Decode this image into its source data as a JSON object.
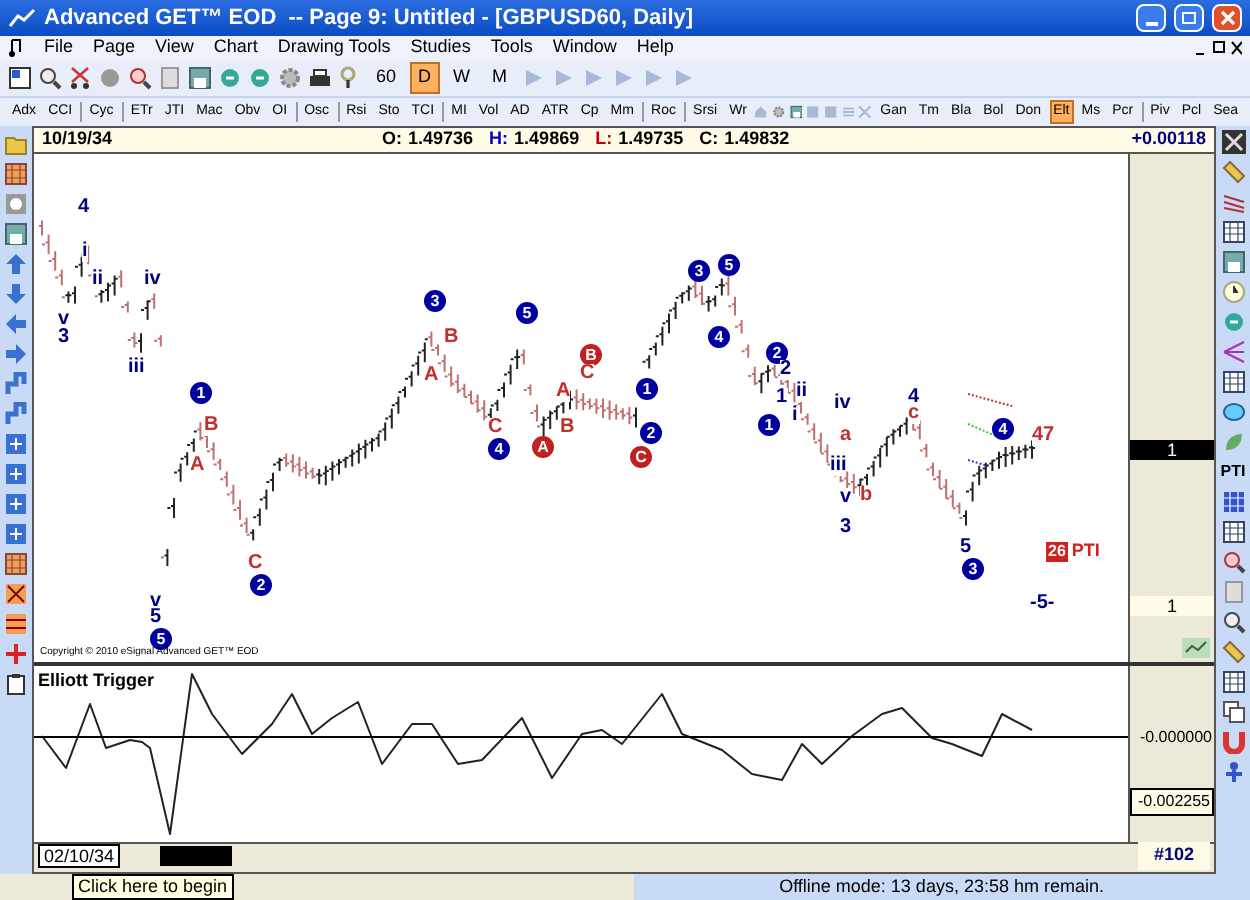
{
  "window": {
    "title": "Advanced GET™ EOD  -- Page 9: Untitled - [GBPUSD60, Daily]"
  },
  "menu": [
    "File",
    "Page",
    "View",
    "Chart",
    "Drawing Tools",
    "Studies",
    "Tools",
    "Window",
    "Help"
  ],
  "timeframes": [
    {
      "label": "60",
      "selected": false
    },
    {
      "label": "D",
      "selected": true
    },
    {
      "label": "W",
      "selected": false
    },
    {
      "label": "M",
      "selected": false
    }
  ],
  "study_groups": [
    [
      {
        "label": "Adx",
        "selected": false
      },
      {
        "label": "CCI",
        "selected": false
      }
    ],
    [
      {
        "label": "Cyc",
        "selected": false
      }
    ],
    [
      {
        "label": "ETr",
        "selected": false
      },
      {
        "label": "JTI",
        "selected": false
      },
      {
        "label": "Mac",
        "selected": false
      },
      {
        "label": "Obv",
        "selected": false
      },
      {
        "label": "OI",
        "selected": false
      }
    ],
    [
      {
        "label": "Osc",
        "selected": false
      }
    ],
    [
      {
        "label": "Rsi",
        "selected": false
      },
      {
        "label": "Sto",
        "selected": false
      },
      {
        "label": "TCI",
        "selected": false
      }
    ],
    [
      {
        "label": "MI",
        "selected": false
      },
      {
        "label": "Vol",
        "selected": false
      },
      {
        "label": "AD",
        "selected": false
      },
      {
        "label": "ATR",
        "selected": false
      },
      {
        "label": "Cp",
        "selected": false
      },
      {
        "label": "Mm",
        "selected": false
      }
    ],
    [
      {
        "label": "Roc",
        "selected": false
      }
    ],
    [
      {
        "label": "Srsi",
        "selected": false
      },
      {
        "label": "Wr",
        "selected": false
      }
    ]
  ],
  "study_groups_right": [
    [
      {
        "label": "Gan",
        "selected": false
      },
      {
        "label": "Tm",
        "selected": false
      },
      {
        "label": "Bla",
        "selected": false
      },
      {
        "label": "Bol",
        "selected": false
      },
      {
        "label": "Don",
        "selected": false
      },
      {
        "label": "Elt",
        "selected": true
      },
      {
        "label": "Ms",
        "selected": false
      },
      {
        "label": "Pcr",
        "selected": false
      }
    ],
    [
      {
        "label": "Piv",
        "selected": false
      },
      {
        "label": "Pcl",
        "selected": false
      },
      {
        "label": "Sea",
        "selected": false
      }
    ]
  ],
  "chart": {
    "date": "10/19/34",
    "ohlc": [
      {
        "label": "O:",
        "value": "1.49736",
        "color": "#000000"
      },
      {
        "label": "H:",
        "value": "1.49869",
        "color": "#0000c0"
      },
      {
        "label": "L:",
        "value": "1.49735",
        "color": "#c00000"
      },
      {
        "label": "C:",
        "value": "1.49832",
        "color": "#000000"
      }
    ],
    "change": "+0.00118",
    "copyright": "Copyright © 2010 eSignal Advanced GET™ EOD",
    "scale_labels": [
      {
        "text": "1",
        "highlighted": true
      },
      {
        "text": "1",
        "highlighted": false
      }
    ],
    "wave_labels": [
      {
        "text": "4",
        "color": "#000080",
        "circled": false
      },
      {
        "text": "i",
        "color": "#000080",
        "circled": false
      },
      {
        "text": "v",
        "color": "#000080",
        "circled": false
      },
      {
        "text": "3",
        "color": "#000080",
        "circled": false
      },
      {
        "text": "ii",
        "color": "#000080",
        "circled": false
      },
      {
        "text": "iv",
        "color": "#000080",
        "circled": false
      },
      {
        "text": "iii",
        "color": "#000080",
        "circled": false
      },
      {
        "text": "1",
        "color": "#0000a0",
        "circled": true
      },
      {
        "text": "B",
        "color": "#c03030",
        "circled": false
      },
      {
        "text": "A",
        "color": "#c03030",
        "circled": false
      },
      {
        "text": "v",
        "color": "#000080",
        "circled": false
      },
      {
        "text": "5",
        "color": "#000080",
        "circled": false
      },
      {
        "text": "5",
        "color": "#0000a0",
        "circled": true
      },
      {
        "text": "C",
        "color": "#c03030",
        "circled": false
      },
      {
        "text": "2",
        "color": "#0000a0",
        "circled": true
      },
      {
        "text": "3",
        "color": "#0000a0",
        "circled": true
      },
      {
        "text": "B",
        "color": "#c03030",
        "circled": false
      },
      {
        "text": "A",
        "color": "#c03030",
        "circled": false
      },
      {
        "text": "5",
        "color": "#0000a0",
        "circled": true
      },
      {
        "text": "C",
        "color": "#c03030",
        "circled": false
      },
      {
        "text": "4",
        "color": "#0000a0",
        "circled": true
      },
      {
        "text": "A",
        "color": "#c02020",
        "circled": true
      },
      {
        "text": "B",
        "color": "#c02020",
        "circled": true
      },
      {
        "text": "C",
        "color": "#c03030",
        "circled": false
      },
      {
        "text": "A",
        "color": "#c03030",
        "circled": false
      },
      {
        "text": "B",
        "color": "#c03030",
        "circled": false
      },
      {
        "text": "1",
        "color": "#0000a0",
        "circled": true
      },
      {
        "text": "2",
        "color": "#0000a0",
        "circled": true
      },
      {
        "text": "C",
        "color": "#c02020",
        "circled": true
      },
      {
        "text": "3",
        "color": "#0000a0",
        "circled": true
      },
      {
        "text": "5",
        "color": "#0000a0",
        "circled": true
      },
      {
        "text": "4",
        "color": "#0000a0",
        "circled": true
      },
      {
        "text": "2",
        "color": "#0000a0",
        "circled": true
      },
      {
        "text": "2",
        "color": "#000080",
        "circled": false
      },
      {
        "text": "1",
        "color": "#000080",
        "circled": false
      },
      {
        "text": "ii",
        "color": "#000080",
        "circled": false
      },
      {
        "text": "i",
        "color": "#000080",
        "circled": false
      },
      {
        "text": "1",
        "color": "#0000a0",
        "circled": true
      },
      {
        "text": "iv",
        "color": "#000080",
        "circled": false
      },
      {
        "text": "a",
        "color": "#c03030",
        "circled": false
      },
      {
        "text": "iii",
        "color": "#000080",
        "circled": false
      },
      {
        "text": "v",
        "color": "#000080",
        "circled": false
      },
      {
        "text": "b",
        "color": "#c03030",
        "circled": false
      },
      {
        "text": "3",
        "color": "#000080",
        "circled": false
      },
      {
        "text": "4",
        "color": "#000080",
        "circled": false
      },
      {
        "text": "c",
        "color": "#c03030",
        "circled": false
      },
      {
        "text": "4",
        "color": "#0000a0",
        "circled": true
      },
      {
        "text": "47",
        "color": "#c03030",
        "circled": false
      },
      {
        "text": "5",
        "color": "#000080",
        "circled": false
      },
      {
        "text": "3",
        "color": "#0000a0",
        "circled": true
      },
      {
        "text": "-5-",
        "color": "#000080",
        "circled": false
      }
    ],
    "pti": {
      "count": "26",
      "label": "PTI"
    }
  },
  "oscillator": {
    "title": "Elliott Trigger",
    "scale": [
      "-0.000000",
      "-0.002255"
    ]
  },
  "footer": {
    "start_date": "02/10/34",
    "bar_number": "#102"
  },
  "right_toolbar_text": "PTI",
  "status": {
    "tooltip": "Click here to begin",
    "message": "Offline mode: 13 days, 23:58 hm remain."
  }
}
